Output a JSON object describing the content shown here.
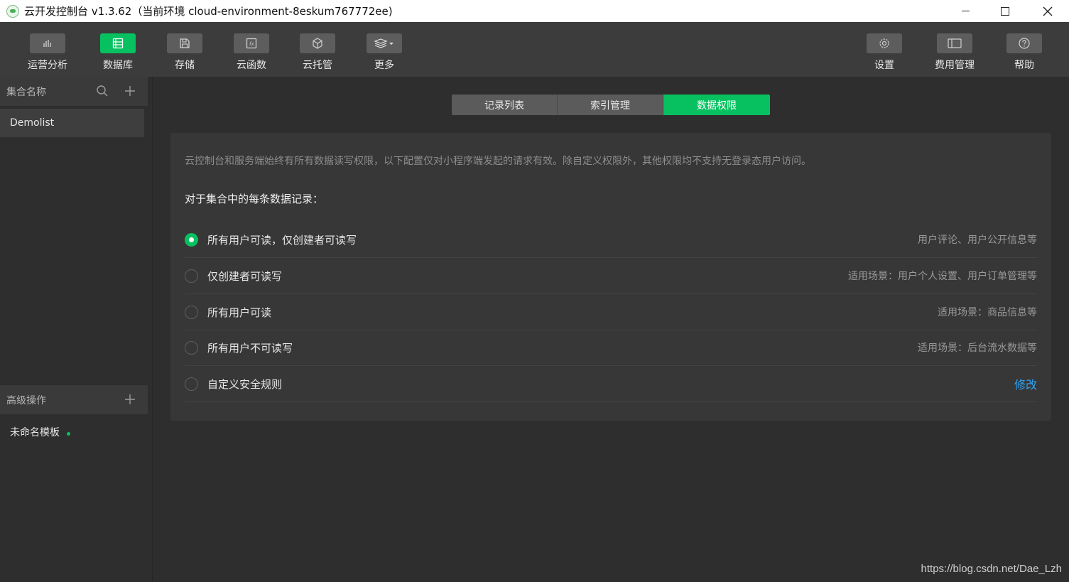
{
  "window": {
    "title": "云开发控制台 v1.3.62（当前环境 cloud-environment-8eskum767772ee)"
  },
  "toolbar": {
    "left": [
      {
        "label": "运营分析",
        "icon": "bar-chart-icon",
        "active": false
      },
      {
        "label": "数据库",
        "icon": "database-icon",
        "active": true
      },
      {
        "label": "存储",
        "icon": "floppy-icon",
        "active": false
      },
      {
        "label": "云函数",
        "icon": "function-icon",
        "active": false
      },
      {
        "label": "云托管",
        "icon": "cube-icon",
        "active": false
      },
      {
        "label": "更多",
        "icon": "layers-dropdown-icon",
        "active": false
      }
    ],
    "right": [
      {
        "label": "设置",
        "icon": "gear-icon"
      },
      {
        "label": "费用管理",
        "icon": "billing-icon"
      },
      {
        "label": "帮助",
        "icon": "help-icon"
      }
    ]
  },
  "sidebar": {
    "collections_header": "集合名称",
    "collections": [
      "Demolist"
    ],
    "advanced_header": "高级操作",
    "templates": [
      "未命名模板"
    ]
  },
  "tabs": [
    "记录列表",
    "索引管理",
    "数据权限"
  ],
  "active_tab": 2,
  "permissions": {
    "notice": "云控制台和服务端始终有所有数据读写权限，以下配置仅对小程序端发起的请求有效。除自定义权限外，其他权限均不支持无登录态用户访问。",
    "subheading": "对于集合中的每条数据记录：",
    "options": [
      {
        "label": "所有用户可读，仅创建者可读写",
        "hint": "用户评论、用户公开信息等",
        "checked": true
      },
      {
        "label": "仅创建者可读写",
        "hint": "适用场景：用户个人设置、用户订单管理等",
        "checked": false
      },
      {
        "label": "所有用户可读",
        "hint": "适用场景：商品信息等",
        "checked": false
      },
      {
        "label": "所有用户不可读写",
        "hint": "适用场景：后台流水数据等",
        "checked": false
      },
      {
        "label": "自定义安全规则",
        "hint": "",
        "checked": false,
        "link": "修改"
      }
    ]
  },
  "watermark": "https://blog.csdn.net/Dae_Lzh",
  "colors": {
    "accent": "#07c160",
    "link": "#2ea3f2"
  }
}
